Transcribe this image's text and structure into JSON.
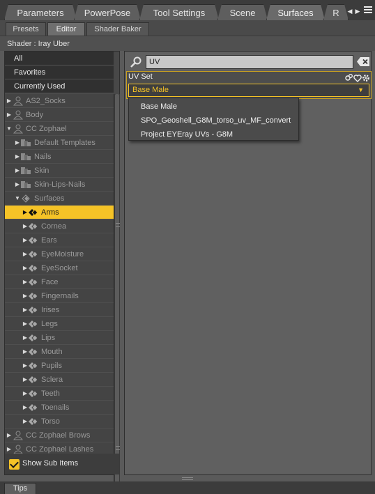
{
  "tabs": {
    "parameters": "Parameters",
    "powerpose": "PowerPose",
    "tool_settings": "Tool Settings",
    "scene": "Scene",
    "surfaces": "Surfaces",
    "overflow": "R"
  },
  "subtabs": {
    "presets": "Presets",
    "editor": "Editor",
    "shader_baker": "Shader Baker"
  },
  "shader_label": "Shader : Iray Uber",
  "filters": {
    "all": "All",
    "favorites": "Favorites",
    "currently_used": "Currently Used"
  },
  "tree": {
    "as2_socks": "AS2_Socks",
    "body": "Body",
    "cc_zophael": "CC Zophael",
    "default_templates": "Default Templates",
    "nails": "Nails",
    "skin": "Skin",
    "skin_lips_nails": "Skin-Lips-Nails",
    "surfaces": "Surfaces",
    "arms": "Arms",
    "cornea": "Cornea",
    "ears": "Ears",
    "eyemoisture": "EyeMoisture",
    "eyesocket": "EyeSocket",
    "face": "Face",
    "fingernails": "Fingernails",
    "irises": "Irises",
    "legs": "Legs",
    "lips": "Lips",
    "mouth": "Mouth",
    "pupils": "Pupils",
    "sclera": "Sclera",
    "teeth": "Teeth",
    "toenails": "Toenails",
    "torso": "Torso",
    "cc_zophael_brows": "CC Zophael Brows",
    "cc_zophael_lashes": "CC Zophael Lashes"
  },
  "show_sub_items": {
    "label": "Show Sub Items",
    "checked": true
  },
  "search": {
    "value": "UV"
  },
  "uv_set": {
    "label": "UV Set",
    "selected": "Base Male",
    "options": {
      "base_male": "Base Male",
      "spo": "SPO_Geoshell_G8M_torso_uv_MF_convert",
      "eyeray": "Project EYEray UVs - G8M"
    }
  },
  "tips": "Tips",
  "colors": {
    "accent": "#f5c327",
    "panel": "#606060",
    "dark": "#303030"
  }
}
